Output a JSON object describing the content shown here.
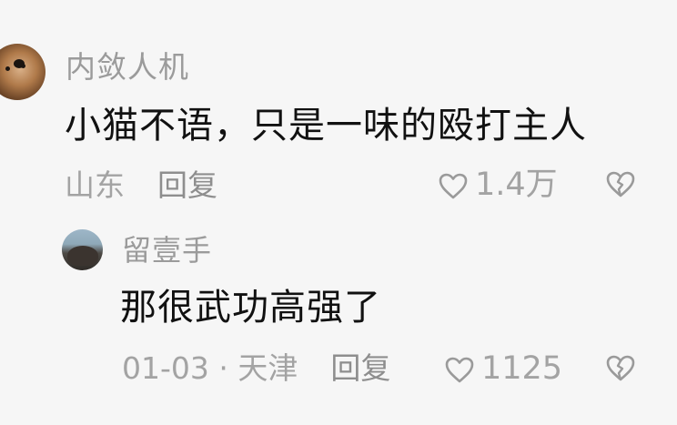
{
  "comment": {
    "username": "内敛人机",
    "text": "小猫不语，只是一味的殴打主人",
    "location": "山东",
    "reply_label": "回复",
    "likes": "1.4万"
  },
  "reply": {
    "username": "留壹手",
    "text": "那很武功高强了",
    "date": "01-03",
    "separator": "·",
    "location": "天津",
    "reply_label": "回复",
    "likes": "1125"
  },
  "icons": {
    "like": "heart-outline-icon",
    "dislike": "broken-heart-icon"
  }
}
